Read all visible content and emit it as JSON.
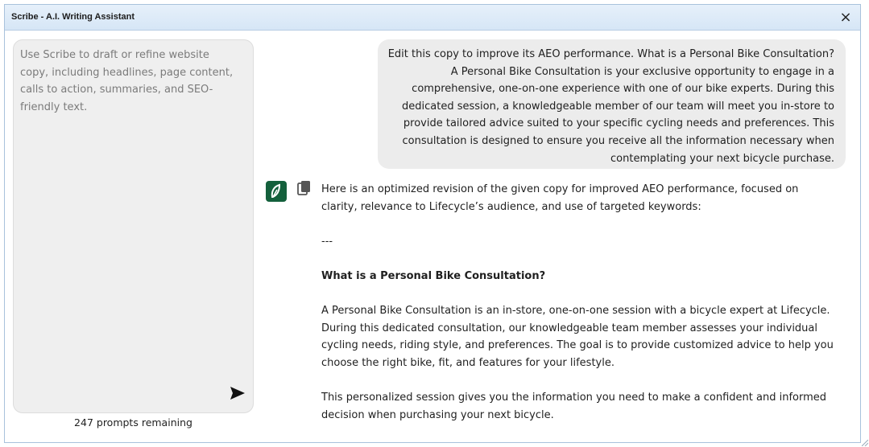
{
  "window": {
    "title": "Scribe - A.I. Writing Assistant",
    "close_icon": "×"
  },
  "input_panel": {
    "placeholder": "Use Scribe to draft or refine website copy, including headlines, page content, calls to action, summaries, and SEO-friendly text.",
    "value": "",
    "send_icon": "send-icon",
    "prompts_remaining": "247 prompts remaining"
  },
  "chat": {
    "user_message": "Edit this copy to improve its AEO performance. What is a Personal Bike Consultation? A Personal Bike Consultation is your exclusive opportunity to engage in a comprehensive, one-on-one experience with one of our bike experts. During this dedicated session, a knowledgeable member of our team will meet you in-store to provide tailored advice suited to your specific cycling needs and preferences. This consultation is designed to ensure you receive all the information necessary when contemplating your next bicycle purchase.",
    "assistant": {
      "avatar_icon": "scribe-logo-icon",
      "copy_icon": "copy-icon",
      "intro": "Here is an optimized revision of the given copy for improved AEO performance, focused on clarity, relevance to Lifecycle’s audience, and use of targeted keywords:",
      "separator": "---",
      "heading": "What is a Personal Bike Consultation?",
      "paragraph1": "A Personal Bike Consultation is an in-store, one-on-one session with a bicycle expert at Lifecycle. During this dedicated consultation, our knowledgeable team member assesses your individual cycling needs, riding style, and preferences. The goal is to provide customized advice to help you choose the right bike, fit, and features for your lifestyle.",
      "paragraph2": "This personalized session gives you the information you need to make a confident and informed decision when purchasing your next bicycle."
    }
  },
  "colors": {
    "titlebar": "#dce9f6",
    "avatar": "#14603c",
    "panel": "#efefef",
    "bubble": "#ececec"
  }
}
